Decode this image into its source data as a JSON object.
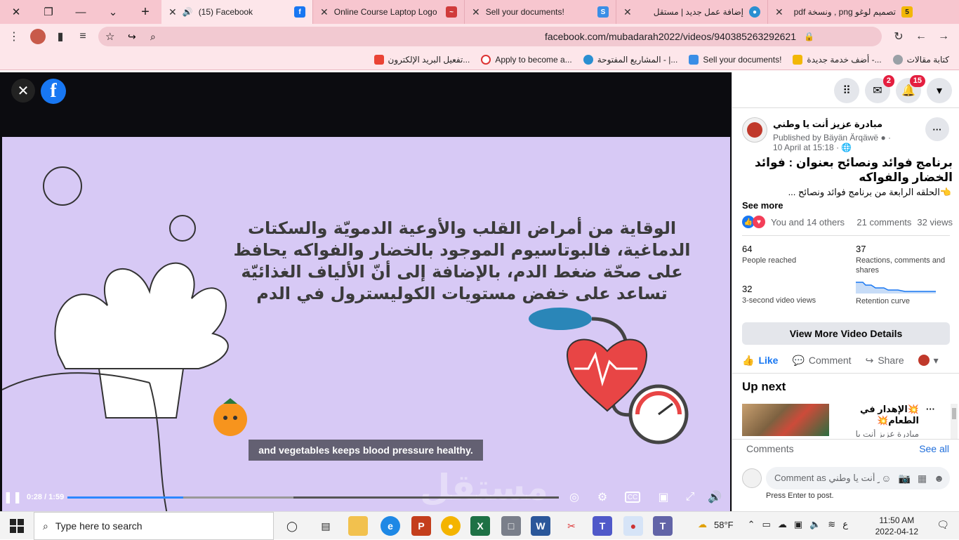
{
  "browser": {
    "tabs": [
      {
        "label": "تصميم لوغو png , ونسخة pdf",
        "active": false
      },
      {
        "label": "إضافة عمل جديد | مستقل",
        "active": false
      },
      {
        "label": "Sell your documents!",
        "active": false
      },
      {
        "label": "Online Course Laptop Logo",
        "active": false
      },
      {
        "label": "(15) Facebook",
        "active": true
      }
    ],
    "new_tab": "+",
    "url": "facebook.com/mubadarah2022/videos/940385263292621",
    "bookmarks": [
      "كتابة مقالات",
      "أضف خدمة جديدة -...",
      "Sell your documents!",
      "المشاريع المفتوحة - |...",
      "Apply to become a...",
      "تفعيل البريد الإلكترون..."
    ]
  },
  "video": {
    "slide_text": "الوقاية من أمراض القلب والأوعية الدمويّة والسكتات الدماغية، فالبوتاسيوم الموجود بالخضار والفواكه يحافظ على صحّة ضغط الدم، بالإضافة إلى أنّ الألياف الغذائيّة تساعد على خفض مستويات الكوليسترول في الدم",
    "caption": "and vegetables keeps blood pressure healthy.",
    "time": "0:28 / 1:59",
    "progress": 0.235,
    "buffered": 0.46,
    "watermark": "مستقل"
  },
  "panel": {
    "badges": {
      "messenger": "2",
      "notifications": "15"
    },
    "page_name": "مبادرة عزيز أنت يا وطني",
    "published_by": "Published by Bäyän Ärqäwë",
    "date": "10 April at 15:18",
    "title": "برنامج فوائد ونصائح بعنوان : فوائد الخضار والفواكه",
    "snippet": "👈الحلقه الرابعة من برنامج فوائد ونصائح ...",
    "see_more": "See more",
    "reactions_text": "You and 14 others",
    "comments_count": "21 comments",
    "views_count": "32 views",
    "stats": [
      {
        "value": "64",
        "label": "People reached"
      },
      {
        "value": "37",
        "label": "Reactions, comments and shares"
      },
      {
        "value": "32",
        "label": "3-second video views"
      },
      {
        "value": "",
        "label": "Retention curve"
      }
    ],
    "view_more": "View More Video Details",
    "like": "Like",
    "comment": "Comment",
    "share": "Share",
    "up_next": "Up next",
    "up_next_title": "💥الإهدار في الطعام💥",
    "up_next_sub": "مبادرة عزيز أنت يا وطني",
    "comments_label": "Comments",
    "see_all": "See all",
    "comment_placeholder": "Comment as مبادرة عزيز أنت يا وطني",
    "press_enter": "Press Enter to post."
  },
  "taskbar": {
    "search": "Type here to search",
    "weather": "58°F",
    "time": "11:50 AM",
    "date": "2022-04-12",
    "lang": "ع"
  },
  "colors": {
    "tab_strip": "#f7c6cf",
    "fb_blue": "#1877f2",
    "slide_bg": "#d7c9f5"
  }
}
